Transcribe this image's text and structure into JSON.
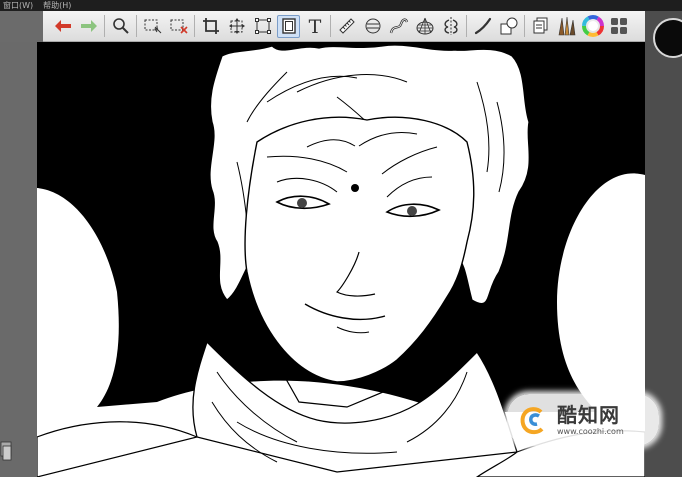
{
  "menubar": {
    "items": [
      {
        "label": "窗口(W)"
      },
      {
        "label": "帮助(H)"
      }
    ]
  },
  "toolbar": {
    "tools": [
      {
        "name": "undo-icon",
        "color": "#d23a2a"
      },
      {
        "name": "redo-icon",
        "color": "#74b86a"
      },
      {
        "name": "zoom-icon"
      },
      {
        "name": "select-rect-icon"
      },
      {
        "name": "clear-selection-icon"
      },
      {
        "name": "crop-icon"
      },
      {
        "name": "move-icon"
      },
      {
        "name": "transform-icon"
      },
      {
        "name": "layer-transform-icon",
        "active": true
      },
      {
        "name": "text-icon",
        "glyph": "T"
      },
      {
        "name": "ruler-icon"
      },
      {
        "name": "ellipse-ruler-icon"
      },
      {
        "name": "curve-ruler-icon"
      },
      {
        "name": "perspective-icon"
      },
      {
        "name": "symmetry-icon"
      },
      {
        "name": "stroke-icon"
      },
      {
        "name": "shape-icon"
      },
      {
        "name": "layer-icon"
      },
      {
        "name": "brush-set-icon"
      },
      {
        "name": "color-wheel-icon"
      },
      {
        "name": "palette-grid-icon"
      }
    ]
  },
  "watermark": {
    "name": "酷知网",
    "url": "www.coozhi.com",
    "logo_colors": [
      "#f5a623",
      "#3b8fd6"
    ]
  },
  "colors": {
    "canvas_bg": "#ffffff",
    "ink": "#000000",
    "toolbar_bg": "#e8e8e8",
    "active_tool": "#cfe0f5"
  }
}
